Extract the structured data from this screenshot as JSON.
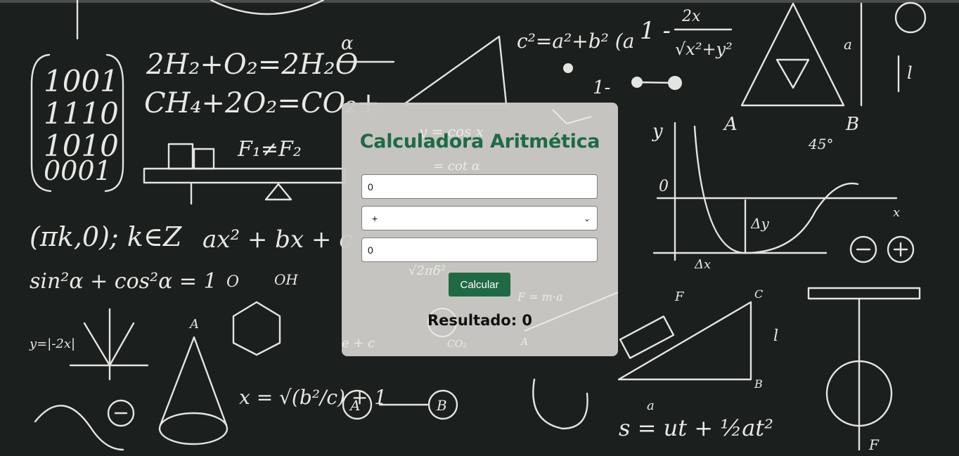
{
  "calculator": {
    "title": "Calculadora Aritmética",
    "first_value": "0",
    "operator_selected": "+",
    "second_value": "0",
    "button_label": "Calcular",
    "result_label": "Resultado: 0"
  },
  "colors": {
    "background": "#1b1f1d",
    "card": "#cccbc8",
    "accent": "#1f6a45"
  },
  "icons": [
    "chevron-down-icon"
  ]
}
